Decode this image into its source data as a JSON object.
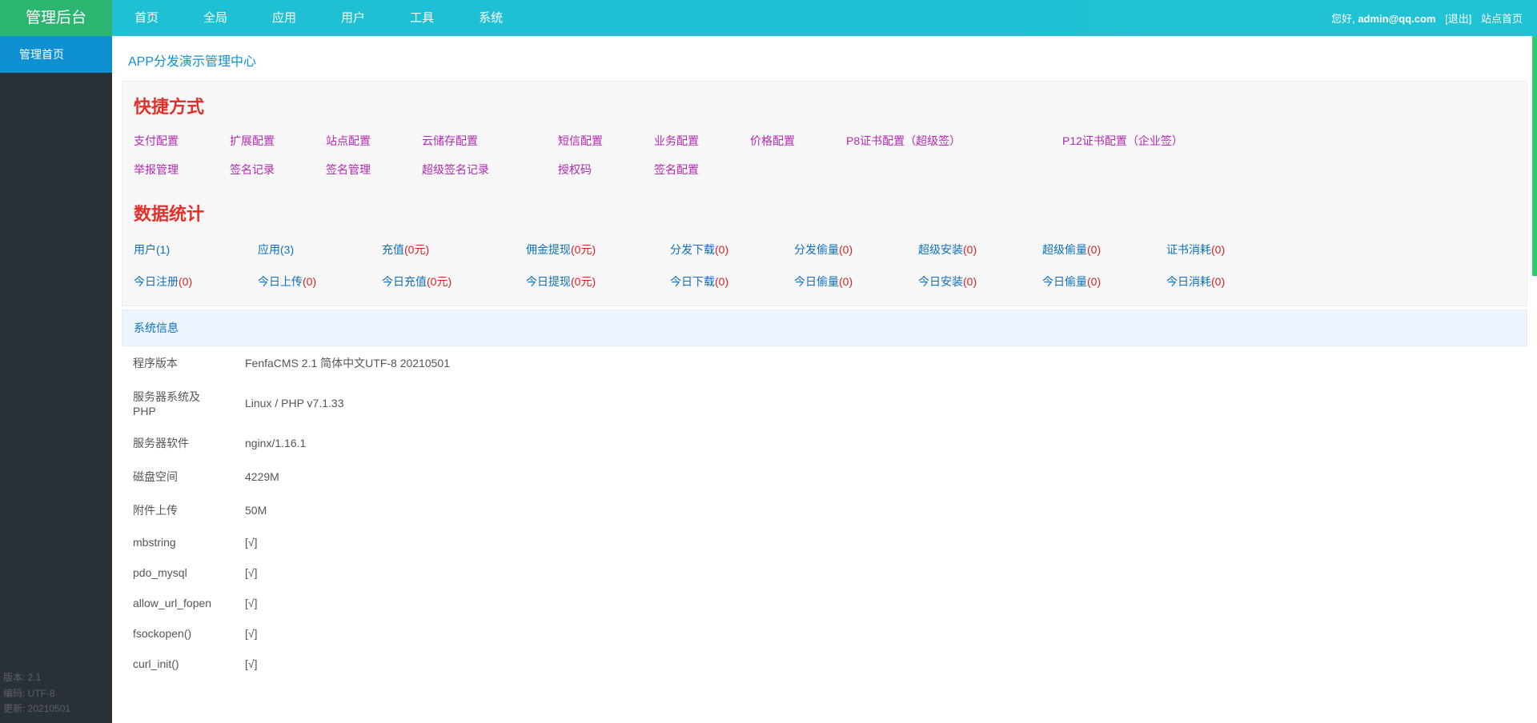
{
  "header": {
    "brand": "管理后台",
    "nav": [
      "首页",
      "全局",
      "应用",
      "用户",
      "工具",
      "系统"
    ],
    "greet_prefix": "您好, ",
    "user": "admin@qq.com",
    "logout": "[退出]",
    "sitelink": "站点首页"
  },
  "sidebar": {
    "active_item": "管理首页",
    "footer": {
      "version_label": "版本: ",
      "version": "2.1",
      "enc_label": "编码: ",
      "enc": "UTF-8",
      "upd_label": "更新: ",
      "upd": "20210501"
    }
  },
  "crumb": "APP分发演示管理中心",
  "shortcuts": {
    "title": "快捷方式",
    "row1": [
      "支付配置",
      "扩展配置",
      "站点配置",
      "云储存配置",
      "短信配置",
      "业务配置",
      "价格配置",
      "P8证书配置（超级签）",
      "P12证书配置（企业签）"
    ],
    "row2": [
      "举报管理",
      "签名记录",
      "签名管理",
      "超级签名记录",
      "授权码",
      "签名配置"
    ]
  },
  "stats": {
    "title": "数据统计",
    "row1": [
      {
        "l": "用户",
        "v": "(1)",
        "red": false
      },
      {
        "l": "应用",
        "v": "(3)",
        "red": false
      },
      {
        "l": "充值",
        "v": "(0元)",
        "red": true
      },
      {
        "l": "佣金提现",
        "v": "(0元)",
        "red": true
      },
      {
        "l": "分发下载",
        "v": "(0)",
        "red": true
      },
      {
        "l": "分发偷量",
        "v": "(0)",
        "red": true
      },
      {
        "l": "超级安装",
        "v": "(0)",
        "red": true
      },
      {
        "l": "超级偷量",
        "v": "(0)",
        "red": true
      },
      {
        "l": "证书消耗",
        "v": "(0)",
        "red": true
      }
    ],
    "row2": [
      {
        "l": "今日注册",
        "v": "(0)",
        "red": true
      },
      {
        "l": "今日上传",
        "v": "(0)",
        "red": true
      },
      {
        "l": "今日充值",
        "v": "(0元)",
        "red": true
      },
      {
        "l": "今日提现",
        "v": "(0元)",
        "red": true
      },
      {
        "l": "今日下载",
        "v": "(0)",
        "red": true
      },
      {
        "l": "今日偷量",
        "v": "(0)",
        "red": true
      },
      {
        "l": "今日安装",
        "v": "(0)",
        "red": true
      },
      {
        "l": "今日偷量",
        "v": "(0)",
        "red": true
      },
      {
        "l": "今日消耗",
        "v": "(0)",
        "red": true
      }
    ]
  },
  "sysinfo": {
    "title": "系统信息",
    "rows": [
      {
        "k": "程序版本",
        "v": "FenfaCMS 2.1 简体中文UTF-8 20210501",
        "ok": false
      },
      {
        "k": "服务器系统及 PHP",
        "v": "Linux / PHP v7.1.33",
        "ok": false
      },
      {
        "k": "服务器软件",
        "v": "nginx/1.16.1",
        "ok": false
      },
      {
        "k": "磁盘空间",
        "v": "4229M",
        "ok": false
      },
      {
        "k": "附件上传",
        "v": "50M",
        "ok": false
      },
      {
        "k": "mbstring",
        "v": "[√]",
        "ok": true
      },
      {
        "k": "pdo_mysql",
        "v": "[√]",
        "ok": true
      },
      {
        "k": "allow_url_fopen",
        "v": "[√]",
        "ok": true
      },
      {
        "k": "fsockopen()",
        "v": "[√]",
        "ok": true
      },
      {
        "k": "curl_init()",
        "v": "[√]",
        "ok": true
      }
    ]
  }
}
